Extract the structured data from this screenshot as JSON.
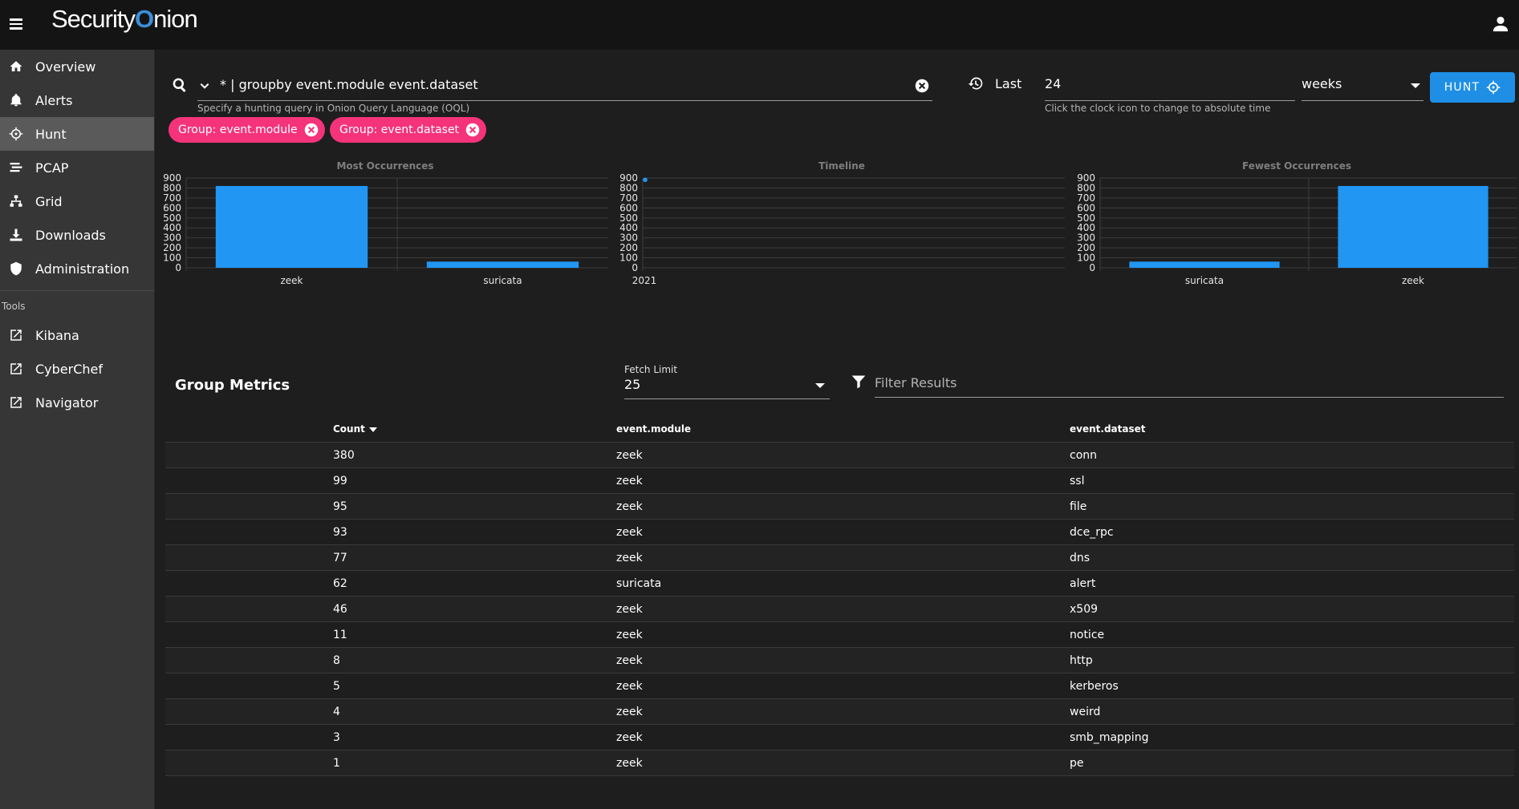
{
  "app": {
    "logo_text_a": "Security",
    "logo_text_b": "nion"
  },
  "sidebar": {
    "items": [
      {
        "label": "Overview",
        "icon": "home-icon"
      },
      {
        "label": "Alerts",
        "icon": "bell-icon"
      },
      {
        "label": "Hunt",
        "icon": "crosshair-icon",
        "active": true
      },
      {
        "label": "PCAP",
        "icon": "stream-icon"
      },
      {
        "label": "Grid",
        "icon": "sitemap-icon"
      },
      {
        "label": "Downloads",
        "icon": "download-icon"
      },
      {
        "label": "Administration",
        "icon": "shield-icon"
      }
    ],
    "tools_label": "Tools",
    "tools": [
      {
        "label": "Kibana",
        "icon": "external-link-icon"
      },
      {
        "label": "CyberChef",
        "icon": "external-link-icon"
      },
      {
        "label": "Navigator",
        "icon": "external-link-icon"
      }
    ]
  },
  "search": {
    "query": "* | groupby event.module event.dataset",
    "hint": "Specify a hunting query in Onion Query Language (OQL)"
  },
  "time": {
    "last_label": "Last",
    "value": "24",
    "unit": "weeks",
    "hint": "Click the clock icon to change to absolute time"
  },
  "hunt_button": "HUNT",
  "chips": [
    {
      "label": "Group: event.module"
    },
    {
      "label": "Group: event.dataset"
    }
  ],
  "colors": {
    "accent": "#1f8fe6",
    "chip": "#f4337a",
    "bar": "#2196f3"
  },
  "chart_data": [
    {
      "type": "bar",
      "title": "Most Occurrences",
      "categories": [
        "zeek",
        "suricata"
      ],
      "values": [
        820,
        62
      ],
      "ylim": [
        0,
        900
      ],
      "yticks": [
        0,
        100,
        200,
        300,
        400,
        500,
        600,
        700,
        800,
        900
      ]
    },
    {
      "type": "scatter",
      "title": "Timeline",
      "x": [
        "2021"
      ],
      "values": [
        882
      ],
      "ylim": [
        0,
        900
      ],
      "yticks": [
        0,
        100,
        200,
        300,
        400,
        500,
        600,
        700,
        800,
        900
      ]
    },
    {
      "type": "bar",
      "title": "Fewest Occurrences",
      "categories": [
        "suricata",
        "zeek"
      ],
      "values": [
        62,
        820
      ],
      "ylim": [
        0,
        900
      ],
      "yticks": [
        0,
        100,
        200,
        300,
        400,
        500,
        600,
        700,
        800,
        900
      ]
    }
  ],
  "metrics": {
    "title": "Group Metrics",
    "fetch_label": "Fetch Limit",
    "fetch_value": "25",
    "filter_placeholder": "Filter Results",
    "headers": [
      "Count",
      "event.module",
      "event.dataset"
    ],
    "rows": [
      [
        "380",
        "zeek",
        "conn"
      ],
      [
        "99",
        "zeek",
        "ssl"
      ],
      [
        "95",
        "zeek",
        "file"
      ],
      [
        "93",
        "zeek",
        "dce_rpc"
      ],
      [
        "77",
        "zeek",
        "dns"
      ],
      [
        "62",
        "suricata",
        "alert"
      ],
      [
        "46",
        "zeek",
        "x509"
      ],
      [
        "11",
        "zeek",
        "notice"
      ],
      [
        "8",
        "zeek",
        "http"
      ],
      [
        "5",
        "zeek",
        "kerberos"
      ],
      [
        "4",
        "zeek",
        "weird"
      ],
      [
        "3",
        "zeek",
        "smb_mapping"
      ],
      [
        "1",
        "zeek",
        "pe"
      ]
    ]
  }
}
